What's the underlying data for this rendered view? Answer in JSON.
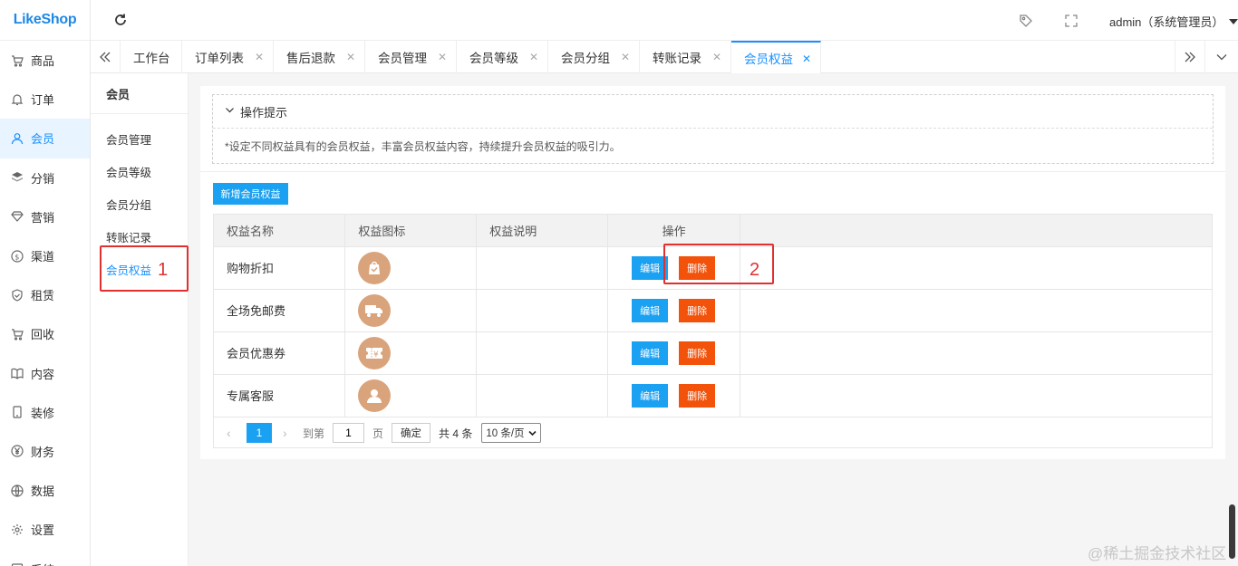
{
  "app": {
    "logo": "LikeShop"
  },
  "sidebar": {
    "items": [
      {
        "label": "商品",
        "icon": "cart-icon"
      },
      {
        "label": "订单",
        "icon": "bell-icon"
      },
      {
        "label": "会员",
        "icon": "user-icon",
        "active": true
      },
      {
        "label": "分销",
        "icon": "layers-icon"
      },
      {
        "label": "营销",
        "icon": "diamond-icon"
      },
      {
        "label": "渠道",
        "icon": "dollar-icon"
      },
      {
        "label": "租赁",
        "icon": "shield-icon"
      },
      {
        "label": "回收",
        "icon": "cart-icon"
      },
      {
        "label": "内容",
        "icon": "book-icon"
      },
      {
        "label": "装修",
        "icon": "phone-icon"
      },
      {
        "label": "财务",
        "icon": "yen-icon"
      },
      {
        "label": "数据",
        "icon": "globe-icon"
      },
      {
        "label": "设置",
        "icon": "gear-icon"
      },
      {
        "label": "系统",
        "icon": "system-icon"
      }
    ]
  },
  "header": {
    "user": "admin（系统管理员）"
  },
  "tabs": [
    {
      "label": "工作台"
    },
    {
      "label": "订单列表"
    },
    {
      "label": "售后退款"
    },
    {
      "label": "会员管理"
    },
    {
      "label": "会员等级"
    },
    {
      "label": "会员分组"
    },
    {
      "label": "转账记录"
    },
    {
      "label": "会员权益",
      "active": true
    }
  ],
  "submenu": {
    "title": "会员",
    "items": [
      {
        "label": "会员管理"
      },
      {
        "label": "会员等级"
      },
      {
        "label": "会员分组"
      },
      {
        "label": "转账记录"
      },
      {
        "label": "会员权益",
        "active": true
      }
    ]
  },
  "tips": {
    "title": "操作提示",
    "body": "*设定不同权益具有的会员权益，丰富会员权益内容，持续提升会员权益的吸引力。"
  },
  "toolbar": {
    "add_label": "新增会员权益"
  },
  "table": {
    "headers": [
      "权益名称",
      "权益图标",
      "权益说明",
      "操作"
    ],
    "rows": [
      {
        "name": "购物折扣",
        "icon": "shopping-bag-icon",
        "desc": ""
      },
      {
        "name": "全场免邮费",
        "icon": "truck-icon",
        "desc": ""
      },
      {
        "name": "会员优惠券",
        "icon": "coupon-icon",
        "desc": ""
      },
      {
        "name": "专属客服",
        "icon": "user-icon",
        "desc": ""
      }
    ],
    "edit_label": "编辑",
    "delete_label": "删除"
  },
  "pager": {
    "current": "1",
    "goto_label": "到第",
    "goto_value": "1",
    "page_label": "页",
    "confirm_label": "确定",
    "total_label": "共 4 条",
    "page_size": "10 条/页"
  },
  "annotations": {
    "one": "1",
    "two": "2"
  },
  "watermark": "@稀土掘金技术社区",
  "colors": {
    "primary": "#1ba1f2",
    "danger": "#f2520a",
    "annotation": "#e03030",
    "icon_bg": "#d9a47c"
  }
}
